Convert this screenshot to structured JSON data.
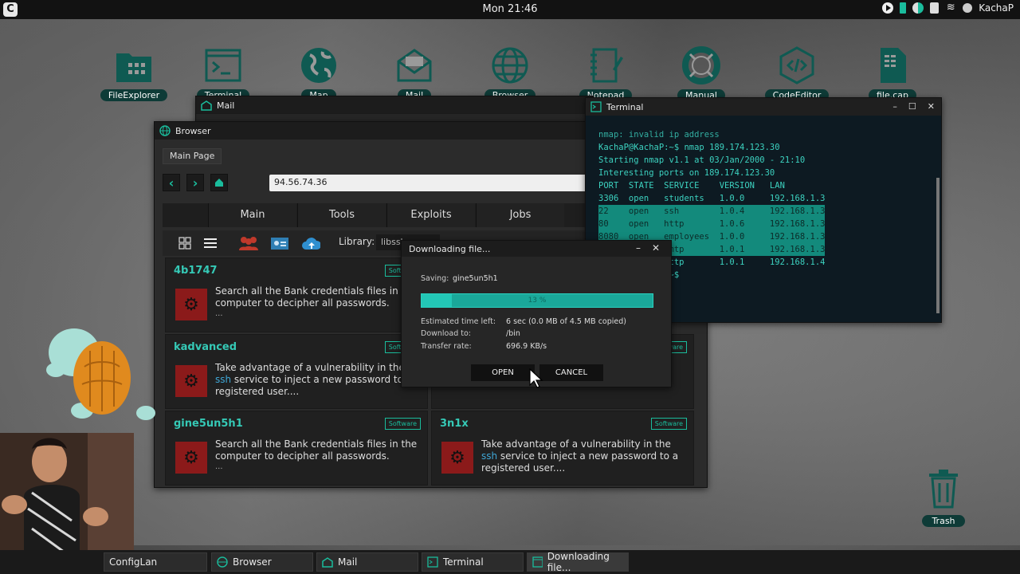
{
  "topbar": {
    "clock": "Mon 21:46",
    "user": "KachaP"
  },
  "desktop_icons": [
    {
      "label": "FileExplorer",
      "icon": "folder-icon"
    },
    {
      "label": "Terminal",
      "icon": "terminal-icon"
    },
    {
      "label": "Map",
      "icon": "globe-map-icon"
    },
    {
      "label": "Mail",
      "icon": "mail-icon"
    },
    {
      "label": "Browser",
      "icon": "browser-globe-icon"
    },
    {
      "label": "Notepad",
      "icon": "notepad-icon"
    },
    {
      "label": "Manual",
      "icon": "lifebuoy-icon"
    },
    {
      "label": "CodeEditor",
      "icon": "code-icon"
    },
    {
      "label": "file.cap",
      "icon": "file-icon"
    }
  ],
  "mail_window": {
    "title": "Mail"
  },
  "browser": {
    "title": "Browser",
    "tab": "Main Page",
    "url": "94.56.74.36",
    "nav_tabs": [
      "Main",
      "Tools",
      "Exploits",
      "Jobs"
    ],
    "library_label": "Library:",
    "library_value": "libssh",
    "cards": [
      {
        "title": "4b1747",
        "tag": "Software",
        "desc": "Search all the Bank credentials files in the computer to decipher all passwords.",
        "more": "..."
      },
      {
        "title": "kadvanced",
        "tag": "Software",
        "desc_pre": "Take advantage of a vulnerability in the ",
        "desc_hl": "ssh",
        "desc_post": " service to inject a new password to a registered user....",
        "more": ""
      },
      {
        "title": "gine5un5h1",
        "tag": "Software",
        "desc": "Search all the Bank credentials files in the computer to decipher all passwords.",
        "more": "..."
      },
      {
        "title": "3n1x",
        "tag": "Software",
        "desc_pre": "Take advantage of a vulnerability in the ",
        "desc_hl": "ssh",
        "desc_post": " service to inject a new password to a registered user....",
        "more": ""
      }
    ]
  },
  "terminal": {
    "title": "Terminal",
    "lines": [
      "nmap: invalid ip address",
      "KachaP@KachaP:~$ nmap 189.174.123.30",
      "",
      "Starting nmap v1.1 at 03/Jan/2000 - 21:10",
      "Interesting ports on 189.174.123.30",
      "",
      "PORT  STATE  SERVICE    VERSION   LAN",
      "3306  open   students   1.0.0     192.168.1.3",
      "22    open   ssh        1.0.4     192.168.1.3",
      "80    open   http       1.0.6     192.168.1.3",
      "8080  open   employees  1.0.0     192.168.1.3",
      "25    open   smtp       1.0.1     192.168.1.3",
      "80    open   http       1.0.1     192.168.1.4",
      "",
      "KachaP@KachaP:~$"
    ]
  },
  "download": {
    "title": "Downloading file...",
    "saving_label": "Saving:",
    "saving_value": "gine5un5h1",
    "progress": 13,
    "progress_text": "13 %",
    "eta_label": "Estimated time left:",
    "eta_value": "6 sec (0.0 MB of 4.5 MB copied)",
    "to_label": "Download to:",
    "to_value": "/bin",
    "rate_label": "Transfer rate:",
    "rate_value": "696.9 KB/s",
    "open_label": "OPEN",
    "cancel_label": "CANCEL"
  },
  "trash": {
    "label": "Trash"
  },
  "taskbar": [
    {
      "label": "ConfigLan"
    },
    {
      "label": "Browser"
    },
    {
      "label": "Mail"
    },
    {
      "label": "Terminal"
    },
    {
      "label": "Downloading file..."
    }
  ]
}
